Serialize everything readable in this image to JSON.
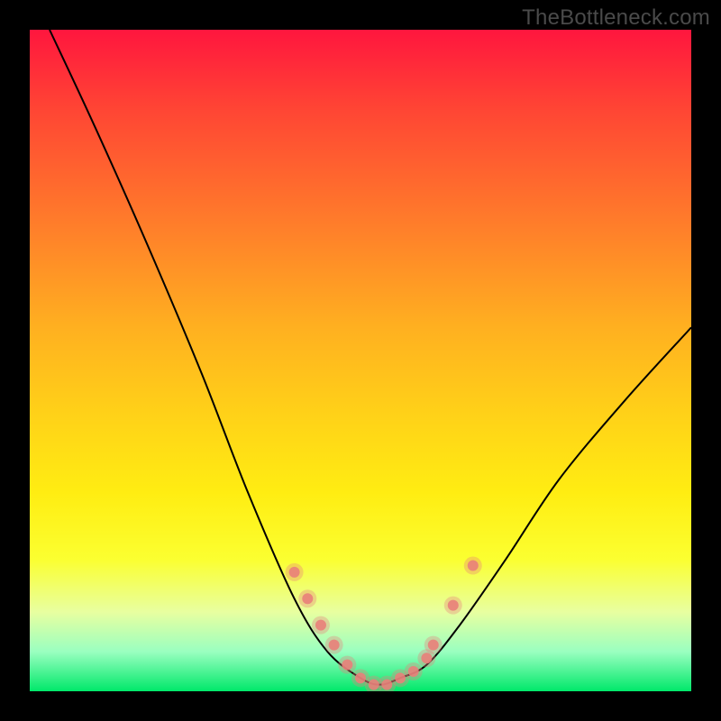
{
  "watermark": "TheBottleneck.com",
  "chart_data": {
    "type": "line",
    "title": "",
    "xlabel": "",
    "ylabel": "",
    "xlim": [
      0,
      100
    ],
    "ylim": [
      0,
      100
    ],
    "series": [
      {
        "name": "bottleneck-curve",
        "x": [
          3,
          10,
          18,
          26,
          33,
          40,
          45,
          50,
          53,
          56,
          60,
          65,
          72,
          80,
          90,
          100
        ],
        "values": [
          100,
          85,
          67,
          48,
          30,
          14,
          6,
          2,
          1,
          2,
          4,
          10,
          20,
          32,
          44,
          55
        ]
      }
    ],
    "markers": {
      "name": "highlight-dots",
      "color": "#e97f7a",
      "x": [
        40,
        42,
        44,
        46,
        48,
        50,
        52,
        54,
        56,
        58,
        60,
        61,
        64,
        67
      ],
      "values": [
        18,
        14,
        10,
        7,
        4,
        2,
        1,
        1,
        2,
        3,
        5,
        7,
        13,
        19
      ]
    }
  }
}
